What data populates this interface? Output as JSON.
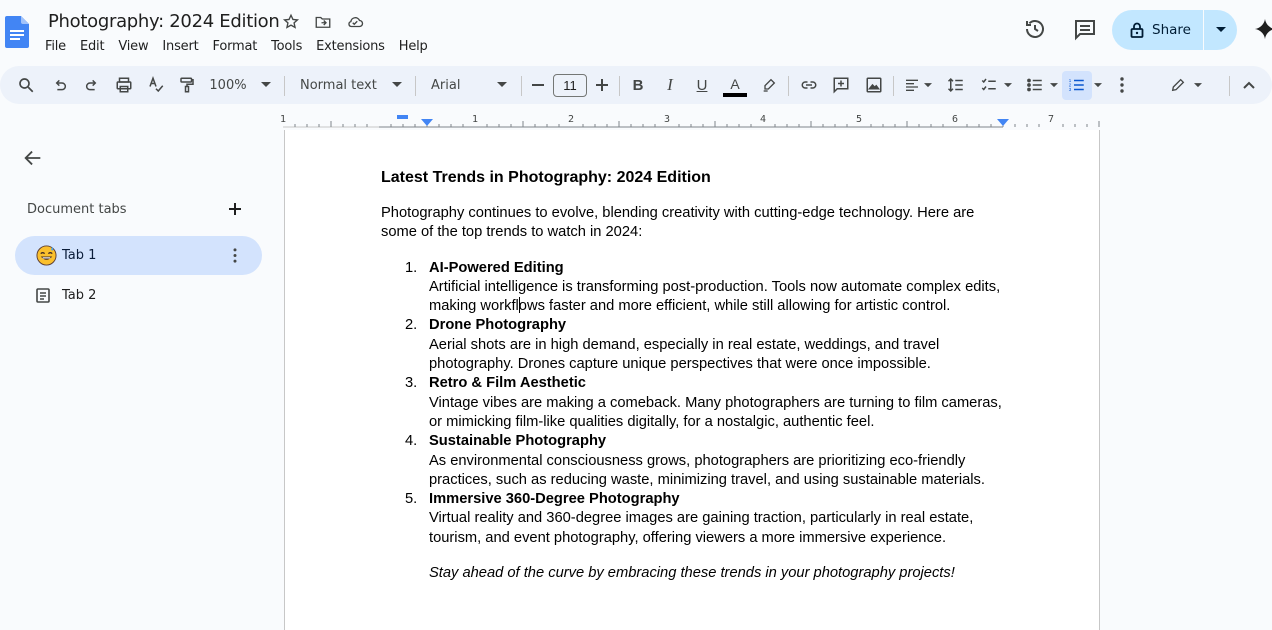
{
  "app": {
    "doc_title": "Photography: 2024 Edition",
    "menu": [
      "File",
      "Edit",
      "View",
      "Insert",
      "Format",
      "Tools",
      "Extensions",
      "Help"
    ],
    "share_label": "Share",
    "accent": "#1a73e8",
    "share_bg": "#c2e7ff"
  },
  "toolbar": {
    "zoom": "100%",
    "style": "Normal text",
    "font": "Arial",
    "font_size": "11"
  },
  "ruler": {
    "labels": [
      "1",
      "1",
      "2",
      "3",
      "4",
      "5",
      "6",
      "7"
    ]
  },
  "sidebar": {
    "heading": "Document tabs",
    "tabs": [
      {
        "label": "Tab 1",
        "icon": "emoji-icon",
        "active": true
      },
      {
        "label": "Tab 2",
        "icon": "document-icon",
        "active": false
      }
    ]
  },
  "document": {
    "heading": "Latest Trends in Photography: 2024 Edition",
    "intro": "Photography continues to evolve, blending creativity with cutting-edge technology. Here are some of the top trends to watch in 2024:",
    "items": [
      {
        "num": "1.",
        "title": "AI-Powered Editing",
        "body_a": "Artificial intelligence is transforming post-production. Tools now automate complex edits, making workfl",
        "body_b": "ows faster and more efficient, while still allowing for artistic control."
      },
      {
        "num": "2.",
        "title": "Drone Photography",
        "body": "Aerial shots are in high demand, especially in real estate, weddings, and travel photography. Drones capture unique perspectives that were once impossible."
      },
      {
        "num": "3.",
        "title": "Retro & Film Aesthetic",
        "body": "Vintage vibes are making a comeback. Many photographers are turning to film cameras, or mimicking film-like qualities digitally, for a nostalgic, authentic feel."
      },
      {
        "num": "4.",
        "title": "Sustainable Photography",
        "body": "As environmental consciousness grows, photographers are prioritizing eco-friendly practices, such as reducing waste, minimizing travel, and using sustainable materials."
      },
      {
        "num": "5.",
        "title": "Immersive 360-Degree Photography",
        "body": "Virtual reality and 360-degree images are gaining traction, particularly in real estate, tourism, and event photography, offering viewers a more immersive experience."
      }
    ],
    "closing": "Stay ahead of the curve by embracing these trends in your photography projects!"
  }
}
